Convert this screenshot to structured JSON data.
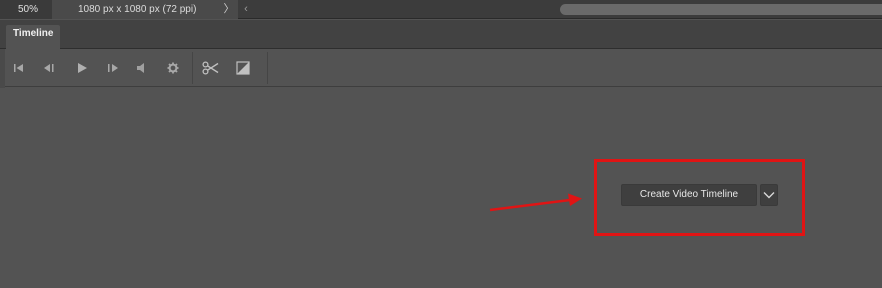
{
  "status_bar": {
    "zoom": "50%",
    "document_info": "1080 px x 1080 px (72 ppi)",
    "info_arrow": "〉",
    "scroll_left_arrow": "‹"
  },
  "panel": {
    "tab_label": "Timeline"
  },
  "toolbar": {
    "icons": [
      "go-to-first-frame-icon",
      "go-to-previous-frame-icon",
      "play-icon",
      "go-to-next-frame-icon",
      "audio-icon",
      "settings-gear-icon",
      "split-at-playhead-icon",
      "transition-icon"
    ]
  },
  "main": {
    "create_button_label": "Create Video Timeline",
    "dropdown_icon": "chevron-down-icon"
  },
  "annotation": {
    "highlight_color": "#e01414",
    "arrow_color": "#e01414"
  }
}
